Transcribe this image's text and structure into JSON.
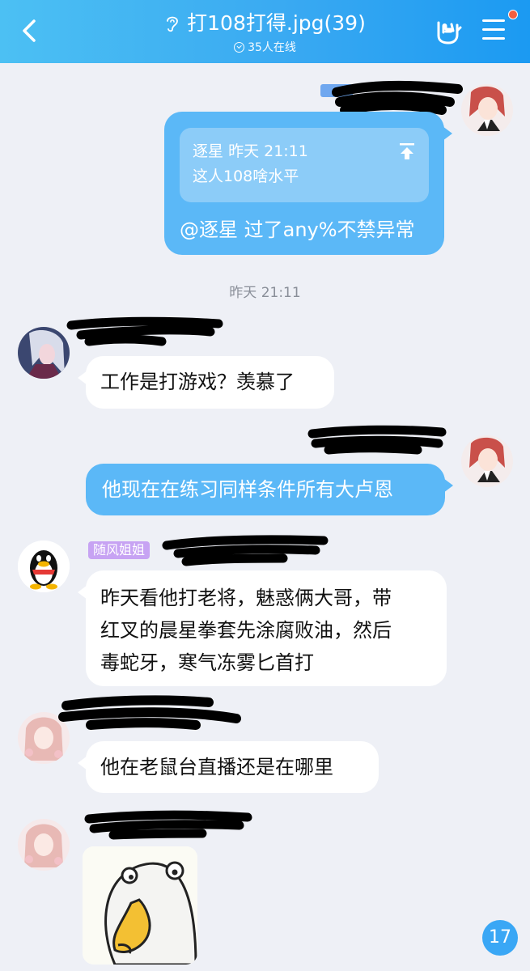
{
  "header": {
    "title": "打108打得.jpg(39)",
    "online": "35人在线",
    "colors": {
      "gradient_start": "#4cc0f3",
      "gradient_end": "#1b9af2"
    },
    "icons": [
      "back-arrow-icon",
      "ear-icon",
      "hand-gesture-icon",
      "menu-icon"
    ],
    "notification_dot_color": "#f55f40"
  },
  "messages": {
    "m1": {
      "quote_sender": "逐星",
      "quote_time": "昨天 21:11",
      "quote_text": "这人108啥水平",
      "text": "@逐星 过了any%不禁异常"
    },
    "timestamp": "昨天 21:11",
    "m2": {
      "text": "工作是打游戏？羡慕了"
    },
    "m3": {
      "text": "他现在在练习同样条件所有大卢恩"
    },
    "m4": {
      "sender_tag": "随风姐姐",
      "lines": [
        "昨天看他打老将，魅惑俩大哥，带",
        "红叉的晨星拳套先涂腐败油，然后",
        "毒蛇牙，寒气冻雾匕首打"
      ]
    },
    "m5": {
      "text": "他在老鼠台直播还是在哪里"
    }
  },
  "unread_badge": "17",
  "colors": {
    "background": "#eef0f6",
    "outgoing_bubble": "#5bb8f7",
    "incoming_bubble": "#ffffff",
    "tag": "#c7a3f3",
    "badge": "#3aa7f5"
  }
}
